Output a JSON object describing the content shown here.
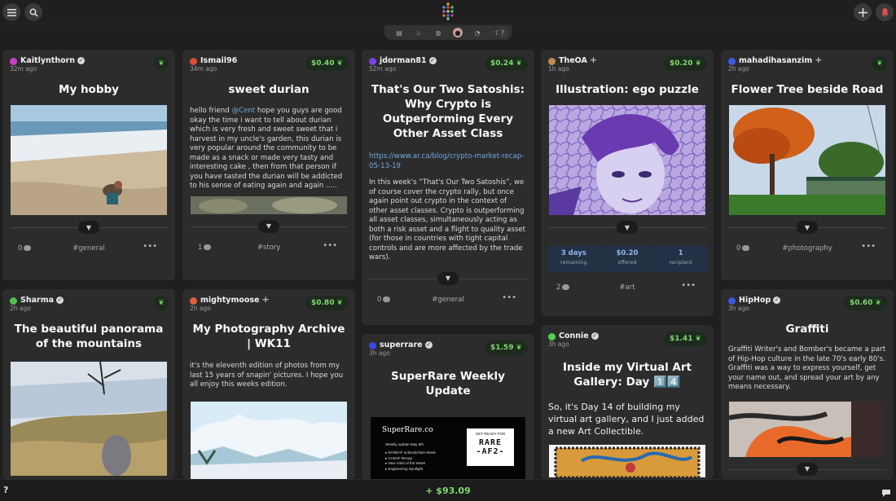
{
  "topbar": {
    "menu_icon": "menu-icon",
    "search_icon": "search-icon",
    "add_icon": "plus-icon",
    "notif_icon": "bell-icon"
  },
  "filters": [
    "list-icon",
    "flame-icon",
    "globe-icon",
    "circle-icon",
    "clock-icon",
    "sort-icon"
  ],
  "help_small": "?",
  "cards": {
    "c1": {
      "user": "Kaitlynthorn",
      "ago": "32m ago",
      "title": "My hobby",
      "comments": "0",
      "tag": "#general",
      "more": "•••"
    },
    "c2": {
      "user": "Ismail96",
      "ago": "34m ago",
      "reward": "$0.40",
      "title": "sweet durian",
      "body_pre": "hello friend ",
      "body_mention": "@Cent",
      "body_post": " hope you guys are good okay the time i want to tell about durian which is very fresh and sweet sweet that i harvest in my uncle's garden, this durian is very popular around the community to be made as a snack or made very tasty and interesting cake , then from that person if you have tasted the durian will be addicted to his sense of eating again and again .....",
      "comments": "1",
      "tag": "#story",
      "more": "•••"
    },
    "c3": {
      "user": "jdorman81",
      "ago": "52m ago",
      "reward": "$0.24",
      "title": "That's Our Two Satoshis: Why Crypto is Outperforming Every Other Asset Class",
      "link": "https://www.ar.ca/blog/crypto-market-recap-05-13-19",
      "body": "In this week's “That's Our Two Satoshis”, we of course cover the crypto rally, but once again point out crypto in the context of other asset classes. Crypto is outperforming all asset classes, simultaneously acting as both a risk asset and a flight to quality asset (for those in countries with tight capital controls and are more affected by the trade wars).",
      "comments": "0",
      "tag": "#general",
      "more": "•••"
    },
    "c4": {
      "user": "TheOA",
      "ago": "1h ago",
      "reward": "$0.20",
      "title": "Illustration: ego puzzle",
      "stat1_v": "3 days",
      "stat1_l": "remaining",
      "stat2_v": "$0.20",
      "stat2_l": "offered",
      "stat3_v": "1",
      "stat3_l": "recipient",
      "comments": "2",
      "tag": "#art",
      "more": "•••"
    },
    "c5": {
      "user": "mahadihasanzim",
      "ago": "2h ago",
      "title": "Flower Tree beside Road",
      "comments": "0",
      "tag": "#photography",
      "more": "•••"
    },
    "c6": {
      "user": "Sharma",
      "ago": "2h ago",
      "title": "The beautiful panorama of the mountains"
    },
    "c7": {
      "user": "mightymoose",
      "ago": "2h ago",
      "reward": "$0.80",
      "title": "My Photography Archive | WK11",
      "body": "it's the eleventh edition of photos from my last 15 years of snapin' pictures. I hope you all enjoy this weeks edition."
    },
    "c8": {
      "user": "superrare",
      "ago": "3h ago",
      "reward": "$1.59",
      "title": "SuperRare Weekly Update",
      "img_brand": "SuperRare.co",
      "img_sub": "Weekly update May 9th",
      "img_items": [
        "RAREAF & Blockchain Week",
        "CADAF Recap",
        "New Artist of the Week",
        "Engineering Spotlight"
      ],
      "img_ready": "GET READY FOR",
      "img_rare": "RARE",
      "img_af": "-AF2-"
    },
    "c9": {
      "user": "Connie",
      "ago": "3h ago",
      "reward": "$1.41",
      "title": "Inside my Virtual Art Gallery: Day 1️⃣4️⃣",
      "body": "So, it's Day 14 of building my virtual art gallery, and I just added a new Art Collectible."
    },
    "c10": {
      "user": "HipHop",
      "ago": "3h ago",
      "reward": "$0.60",
      "title": "Graffiti",
      "body": "Graffiti Writer's and Bomber's became a part of Hip-Hop culture in the late 70's early 80's. Graffiti was a way to express yourself, get your name out, and spread your art by any means necessary."
    }
  },
  "bottom": {
    "help": "?",
    "total": "+ $93.09",
    "chat_icon": "chat-icon"
  },
  "colors": {
    "accent_green": "#7fd86e",
    "link_blue": "#6fa8dc",
    "bg": "#1f1f1f",
    "card": "#2c2c2c"
  }
}
